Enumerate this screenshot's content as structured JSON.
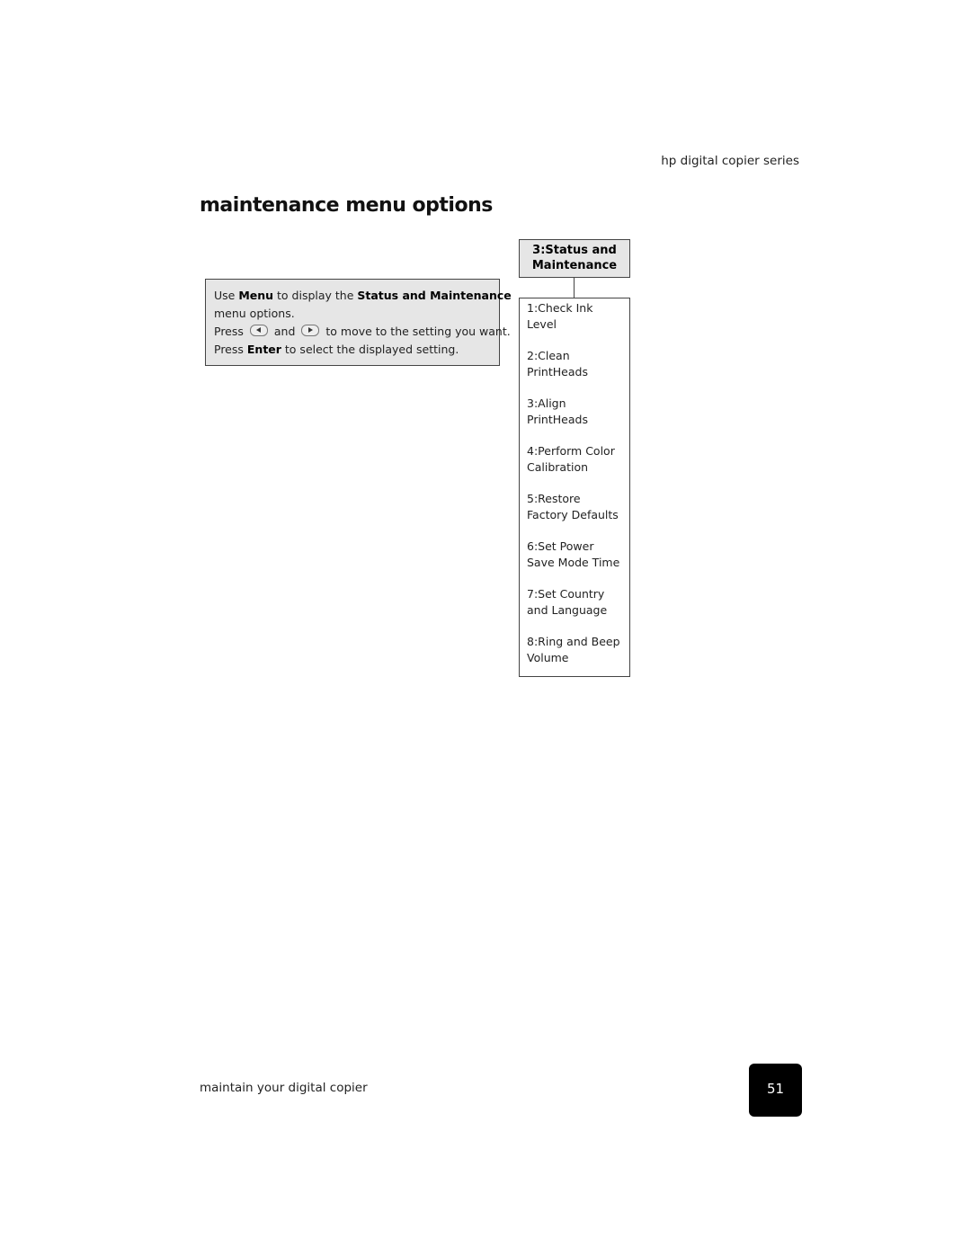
{
  "header": {
    "series": "hp digital copier series"
  },
  "page_title": "maintenance menu options",
  "instructions": {
    "line1_pre": "Use ",
    "line1_bold1": "Menu",
    "line1_mid": " to display the ",
    "line1_bold2": "Status and Maintenance",
    "line2": "menu options.",
    "line3_pre": "Press",
    "line3_and": "and",
    "line3_post": "to move to the setting you want.",
    "line4_pre": "Press ",
    "line4_bold": "Enter",
    "line4_post": " to select the displayed setting.",
    "icons": [
      "left-arrow-button-icon",
      "right-arrow-button-icon"
    ]
  },
  "menu": {
    "heading_line1": "3:Status and",
    "heading_line2": "Maintenance",
    "items": [
      {
        "line1": "1:Check Ink",
        "line2": "Level"
      },
      {
        "line1": "2:Clean",
        "line2": "PrintHeads"
      },
      {
        "line1": "3:Align",
        "line2": "PrintHeads"
      },
      {
        "line1": "4:Perform Color",
        "line2": "Calibration"
      },
      {
        "line1": "5:Restore",
        "line2": "Factory Defaults"
      },
      {
        "line1": "6:Set Power",
        "line2": "Save Mode Time"
      },
      {
        "line1": "7:Set Country",
        "line2": "and Language"
      },
      {
        "line1": "8:Ring and Beep",
        "line2": "Volume"
      }
    ]
  },
  "footer": {
    "section": "maintain your digital copier",
    "page_number": "51"
  }
}
